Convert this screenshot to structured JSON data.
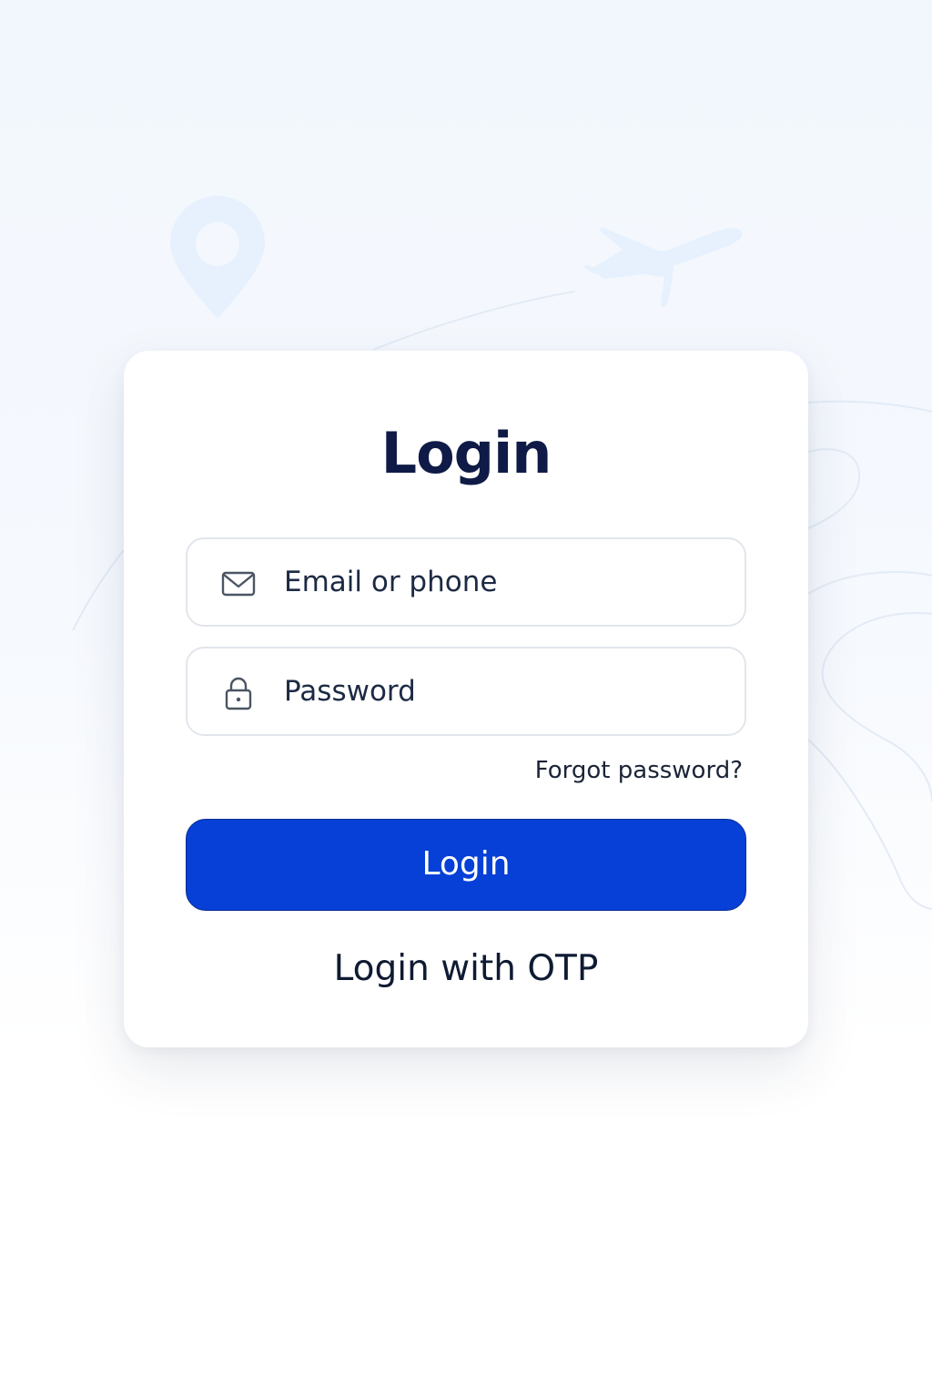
{
  "login": {
    "title": "Login",
    "email": {
      "placeholder": "Email or phone",
      "icon": "envelope-icon"
    },
    "password": {
      "placeholder": "Password",
      "icon": "lock-icon"
    },
    "forgot_label": "Forgot password?",
    "submit_label": "Login",
    "otp_label": "Login with OTP"
  },
  "background": {
    "icons": [
      "map-pin-icon",
      "airplane-icon"
    ]
  },
  "colors": {
    "accent": "#0640d6",
    "title": "#0f1b46",
    "text": "#1d2a44",
    "field_border": "#e2e6ec",
    "decor": "#e6f1fd"
  }
}
